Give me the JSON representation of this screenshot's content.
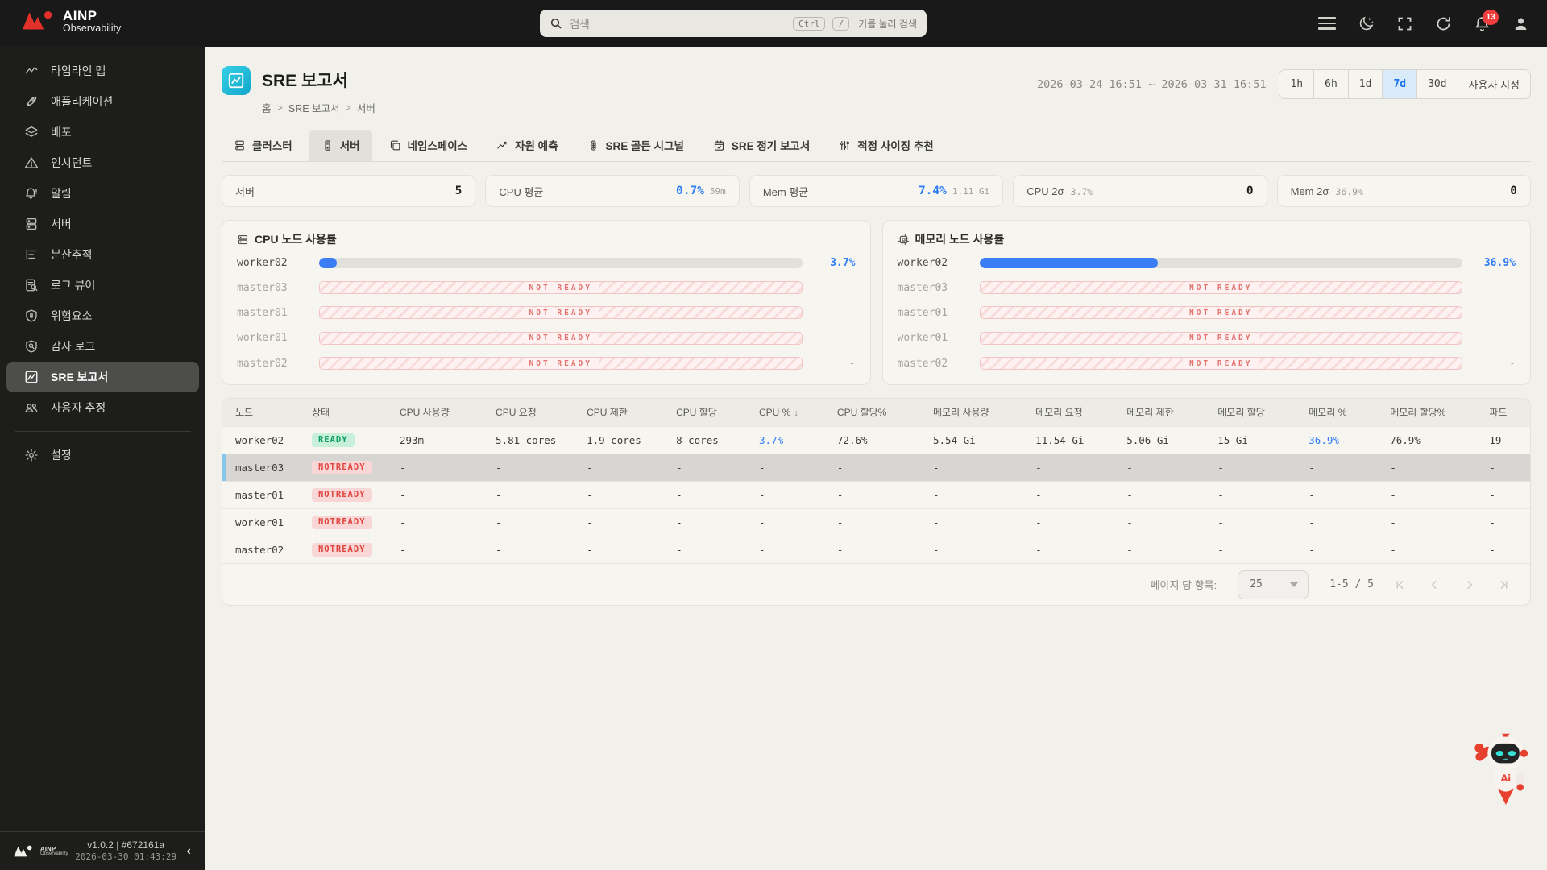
{
  "header": {
    "logo_title": "AINP",
    "logo_subtitle": "Observability",
    "search": {
      "placeholder": "검색",
      "key1": "Ctrl",
      "key2": "/",
      "hint": "키를 눌러 검색"
    },
    "notification_count": "13"
  },
  "sidebar": {
    "items": [
      {
        "id": "partial-top",
        "label": "",
        "icon": "grid",
        "partial": true,
        "active": false
      },
      {
        "id": "timeline-map",
        "label": "타임라인 맵",
        "icon": "timeline",
        "active": false
      },
      {
        "id": "applications",
        "label": "애플리케이션",
        "icon": "rocket",
        "active": false
      },
      {
        "id": "deployments",
        "label": "배포",
        "icon": "layers",
        "active": false
      },
      {
        "id": "incidents",
        "label": "인시던트",
        "icon": "warning",
        "active": false
      },
      {
        "id": "alerts",
        "label": "알림",
        "icon": "bell",
        "active": false
      },
      {
        "id": "servers",
        "label": "서버",
        "icon": "server",
        "active": false
      },
      {
        "id": "tracing",
        "label": "분산추적",
        "icon": "trace",
        "active": false
      },
      {
        "id": "log-viewer",
        "label": "로그 뷰어",
        "icon": "logview",
        "active": false
      },
      {
        "id": "risk-factors",
        "label": "위험요소",
        "icon": "shield-lock",
        "active": false
      },
      {
        "id": "audit-log",
        "label": "감사 로그",
        "icon": "shield-search",
        "active": false
      },
      {
        "id": "sre-report",
        "label": "SRE 보고서",
        "icon": "chart",
        "active": true
      },
      {
        "id": "user-estimation",
        "label": "사용자 추정",
        "icon": "users",
        "active": false
      }
    ],
    "settings": {
      "id": "settings",
      "label": "설정",
      "icon": "gear"
    },
    "footer": {
      "version": "v1.0.2 | #672161a",
      "build_date": "2026-03-30 01:43:29"
    }
  },
  "page": {
    "title": "SRE 보고서",
    "breadcrumb": [
      "홈",
      "SRE 보고서",
      "서버"
    ],
    "date_range": "2026-03-24 16:51 ~ 2026-03-31 16:51",
    "time_buttons": [
      "1h",
      "6h",
      "1d",
      "7d",
      "30d",
      "사용자 지정"
    ],
    "active_time": "7d"
  },
  "tabs": [
    {
      "id": "cluster",
      "label": "클러스터",
      "icon": "cluster",
      "active": false
    },
    {
      "id": "server",
      "label": "서버",
      "icon": "tower",
      "active": true
    },
    {
      "id": "namespace",
      "label": "네임스페이스",
      "icon": "namespace",
      "active": false
    },
    {
      "id": "resource-forecast",
      "label": "자원 예측",
      "icon": "forecast",
      "active": false
    },
    {
      "id": "sre-golden-signal",
      "label": "SRE 골든 시그널",
      "icon": "signal",
      "active": false
    },
    {
      "id": "sre-periodic-report",
      "label": "SRE 정기 보고서",
      "icon": "calendar",
      "active": false
    },
    {
      "id": "right-sizing",
      "label": "적정 사이징 추천",
      "icon": "sliders",
      "active": false
    }
  ],
  "stats": [
    {
      "id": "servers",
      "label": "서버",
      "value": "5",
      "value_style": "dark"
    },
    {
      "id": "cpu-avg",
      "label": "CPU 평균",
      "value": "0.7%",
      "value_style": "blue",
      "sub": "59m"
    },
    {
      "id": "mem-avg",
      "label": "Mem 평균",
      "value": "7.4%",
      "value_style": "blue",
      "sub": "1.11 Gi"
    },
    {
      "id": "cpu-2sigma",
      "label": "CPU 2σ",
      "label_note": "3.7%",
      "value": "0",
      "value_style": "dark"
    },
    {
      "id": "mem-2sigma",
      "label": "Mem 2σ",
      "label_note": "36.9%",
      "value": "0",
      "value_style": "dark"
    }
  ],
  "charts": [
    {
      "id": "cpu-node-usage",
      "title": "CPU 노드 사용률",
      "icon": "cpu",
      "type": "bar",
      "not_ready_label": "NOT READY",
      "empty_value": "-",
      "xlim": [
        0,
        100
      ],
      "rows": [
        {
          "node": "worker02",
          "pct": 3.7,
          "display": "3.7%"
        },
        {
          "node": "master03",
          "not_ready": true
        },
        {
          "node": "master01",
          "not_ready": true
        },
        {
          "node": "worker01",
          "not_ready": true
        },
        {
          "node": "master02",
          "not_ready": true
        }
      ]
    },
    {
      "id": "memory-node-usage",
      "title": "메모리 노드 사용률",
      "icon": "memory",
      "type": "bar",
      "not_ready_label": "NOT READY",
      "empty_value": "-",
      "xlim": [
        0,
        100
      ],
      "rows": [
        {
          "node": "worker02",
          "pct": 36.9,
          "display": "36.9%"
        },
        {
          "node": "master03",
          "not_ready": true
        },
        {
          "node": "master01",
          "not_ready": true
        },
        {
          "node": "worker01",
          "not_ready": true
        },
        {
          "node": "master02",
          "not_ready": true
        }
      ]
    }
  ],
  "table": {
    "columns": [
      {
        "label": "노드"
      },
      {
        "label": "상태"
      },
      {
        "label": "CPU 사용량"
      },
      {
        "label": "CPU 요청"
      },
      {
        "label": "CPU 제한"
      },
      {
        "label": "CPU 할당"
      },
      {
        "label": "CPU %",
        "sorted": "desc"
      },
      {
        "label": "CPU 할당%"
      },
      {
        "label": "메모리 사용량"
      },
      {
        "label": "메모리 요청"
      },
      {
        "label": "메모리 제한"
      },
      {
        "label": "메모리 할당"
      },
      {
        "label": "메모리 %"
      },
      {
        "label": "메모리 할당%"
      },
      {
        "label": "파드"
      }
    ],
    "rows": [
      {
        "node": "worker02",
        "status": "READY",
        "selected": false,
        "cells": [
          "293m",
          "5.81 cores",
          "1.9 cores",
          "8 cores",
          "3.7%",
          "72.6%",
          "5.54 Gi",
          "11.54 Gi",
          "5.06 Gi",
          "15 Gi",
          "36.9%",
          "76.9%",
          "19"
        ]
      },
      {
        "node": "master03",
        "status": "NOTREADY",
        "selected": true,
        "cells": [
          "-",
          "-",
          "-",
          "-",
          "-",
          "-",
          "-",
          "-",
          "-",
          "-",
          "-",
          "-",
          "-"
        ]
      },
      {
        "node": "master01",
        "status": "NOTREADY",
        "selected": false,
        "cells": [
          "-",
          "-",
          "-",
          "-",
          "-",
          "-",
          "-",
          "-",
          "-",
          "-",
          "-",
          "-",
          "-"
        ]
      },
      {
        "node": "worker01",
        "status": "NOTREADY",
        "selected": false,
        "cells": [
          "-",
          "-",
          "-",
          "-",
          "-",
          "-",
          "-",
          "-",
          "-",
          "-",
          "-",
          "-",
          "-"
        ]
      },
      {
        "node": "master02",
        "status": "NOTREADY",
        "selected": false,
        "cells": [
          "-",
          "-",
          "-",
          "-",
          "-",
          "-",
          "-",
          "-",
          "-",
          "-",
          "-",
          "-",
          "-"
        ]
      }
    ]
  },
  "pagination": {
    "items_label": "페이지 당 항목:",
    "per_page": "25",
    "range": "1-5 / 5"
  },
  "colors": {
    "accent_blue": "#2f7df6",
    "success_green": "#0d9f62",
    "danger_red": "#e0453f",
    "brand_red": "#e23128",
    "selected_row_accent": "#86c8ec",
    "title_icon_teal": "#12a7cb"
  }
}
